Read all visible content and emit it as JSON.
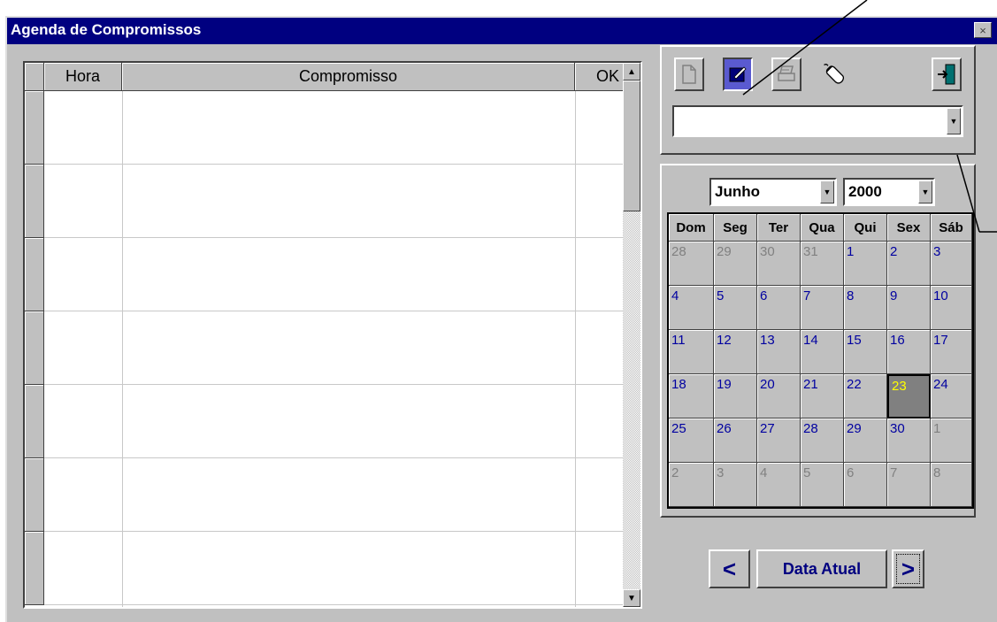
{
  "window": {
    "title": "Agenda de Compromissos",
    "close_glyph": "×"
  },
  "grid": {
    "columns": [
      "Hora",
      "Compromisso",
      "OK"
    ],
    "rows": 7
  },
  "toolbar": {
    "buttons": [
      {
        "name": "new-document-icon",
        "label": "Novo"
      },
      {
        "name": "edit-icon",
        "label": "Editar"
      },
      {
        "name": "printer-icon",
        "label": "Imprimir"
      },
      {
        "name": "mouse-icon",
        "label": "Mouse"
      },
      {
        "name": "exit-door-icon",
        "label": "Sair"
      }
    ],
    "combo_value": ""
  },
  "calendar": {
    "month": "Junho",
    "year": "2000",
    "weekdays": [
      "Dom",
      "Seg",
      "Ter",
      "Qua",
      "Qui",
      "Sex",
      "Sáb"
    ],
    "weeks": [
      [
        [
          "28",
          1
        ],
        [
          "29",
          1
        ],
        [
          "30",
          1
        ],
        [
          "31",
          1
        ],
        [
          "1",
          0
        ],
        [
          "2",
          0
        ],
        [
          "3",
          0
        ]
      ],
      [
        [
          "4",
          0
        ],
        [
          "5",
          0
        ],
        [
          "6",
          0
        ],
        [
          "7",
          0
        ],
        [
          "8",
          0
        ],
        [
          "9",
          0
        ],
        [
          "10",
          0
        ]
      ],
      [
        [
          "11",
          0
        ],
        [
          "12",
          0
        ],
        [
          "13",
          0
        ],
        [
          "14",
          0
        ],
        [
          "15",
          0
        ],
        [
          "16",
          0
        ],
        [
          "17",
          0
        ]
      ],
      [
        [
          "18",
          0
        ],
        [
          "19",
          0
        ],
        [
          "20",
          0
        ],
        [
          "21",
          0
        ],
        [
          "22",
          0
        ],
        [
          "23",
          2
        ],
        [
          "24",
          0
        ]
      ],
      [
        [
          "25",
          0
        ],
        [
          "26",
          0
        ],
        [
          "27",
          0
        ],
        [
          "28",
          0
        ],
        [
          "29",
          0
        ],
        [
          "30",
          0
        ],
        [
          "1",
          1
        ]
      ],
      [
        [
          "2",
          1
        ],
        [
          "3",
          1
        ],
        [
          "4",
          1
        ],
        [
          "5",
          1
        ],
        [
          "6",
          1
        ],
        [
          "7",
          1
        ],
        [
          "8",
          1
        ]
      ]
    ]
  },
  "nav": {
    "prev_label": "<",
    "today_label": "Data Atual",
    "next_label": ">"
  },
  "colors": {
    "title_bar": "#000080",
    "face": "#c0c0c0",
    "day_text": "#0000a0",
    "today_text": "#ffff00"
  }
}
